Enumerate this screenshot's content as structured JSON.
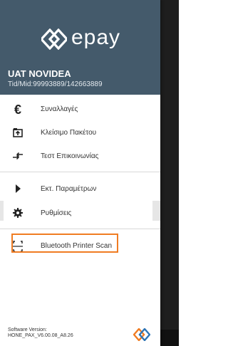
{
  "header": {
    "brand": "epay",
    "merchant": "UAT NOVIDEA",
    "ids": "Tid/Mid:99993889/142663889"
  },
  "menu": {
    "items": [
      {
        "label": "Συναλλαγές",
        "icon": "euro-icon"
      },
      {
        "label": "Κλείσιμο Πακέτου",
        "icon": "batch-close-icon"
      },
      {
        "label": "Τεστ Επικοινωνίας",
        "icon": "connection-test-icon"
      },
      {
        "label": "Εκτ. Παραμέτρων",
        "icon": "play-arrow-icon"
      },
      {
        "label": "Ρυθμίσεις",
        "icon": "gear-icon"
      },
      {
        "label": "Bluetooth Printer Scan",
        "icon": "bluetooth-scan-icon"
      }
    ]
  },
  "footer": {
    "version_label": "Software Version:",
    "version_value": "HONE_PAX_V6.00.08_A8.26"
  },
  "colors": {
    "header_bg": "#445a6b",
    "highlight": "#f07c22",
    "brand_orange": "#f07c22",
    "brand_blue": "#2e74b5"
  }
}
